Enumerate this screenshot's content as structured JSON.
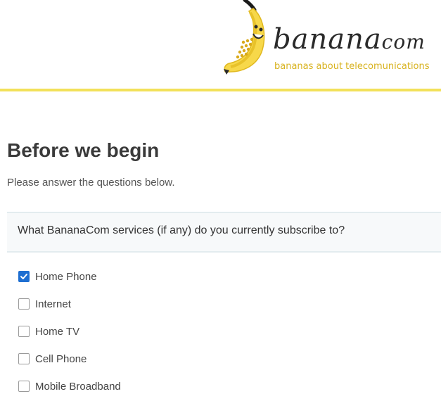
{
  "header": {
    "brand_main": "banana",
    "brand_small": "com",
    "tagline": "bananas about telecomunications",
    "accent_color": "#f2e15a",
    "tagline_color": "#d8b21d"
  },
  "page": {
    "title": "Before we begin",
    "subtitle": "Please answer the questions below."
  },
  "question": {
    "text": "What BananaCom services (if any) do you currently subscribe to?",
    "options": [
      {
        "label": "Home Phone",
        "checked": true
      },
      {
        "label": "Internet",
        "checked": false
      },
      {
        "label": "Home TV",
        "checked": false
      },
      {
        "label": "Cell Phone",
        "checked": false
      },
      {
        "label": "Mobile Broadband",
        "checked": false
      }
    ],
    "check_color": "#1f6fd1"
  }
}
